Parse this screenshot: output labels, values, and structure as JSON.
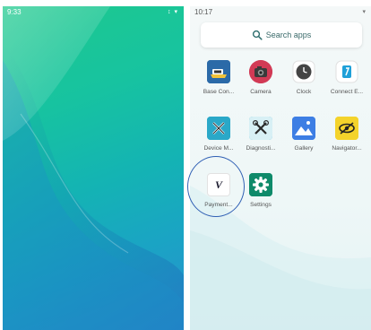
{
  "left_phone": {
    "status_bar": {
      "time": "9:33",
      "icons": "↕ ▾"
    }
  },
  "right_phone": {
    "status_bar": {
      "time": "10:17",
      "icons": "▾"
    },
    "search": {
      "label": "Search apps"
    },
    "apps": [
      {
        "label": "Base Con...",
        "icon": "base-connection-icon"
      },
      {
        "label": "Camera",
        "icon": "camera-icon"
      },
      {
        "label": "Clock",
        "icon": "clock-icon"
      },
      {
        "label": "Connect E...",
        "icon": "connect-icon"
      },
      {
        "label": "Device M...",
        "icon": "device-manager-icon"
      },
      {
        "label": "Diagnosti...",
        "icon": "diagnostics-icon"
      },
      {
        "label": "Gallery",
        "icon": "gallery-icon"
      },
      {
        "label": "Navigator...",
        "icon": "navigator-icon"
      },
      {
        "label": "Payment...",
        "icon": "payment-icon",
        "icon_text": "V"
      },
      {
        "label": "Settings",
        "icon": "settings-icon"
      }
    ]
  },
  "colors": {
    "home_gradient_top": "#1ec98d",
    "home_gradient_bottom": "#2a8fd0",
    "drawer_background": "#eef7f7",
    "highlight_ring": "#2f5fb4",
    "settings_green": "#0f8a6a",
    "device_teal": "#2aa8c8"
  }
}
